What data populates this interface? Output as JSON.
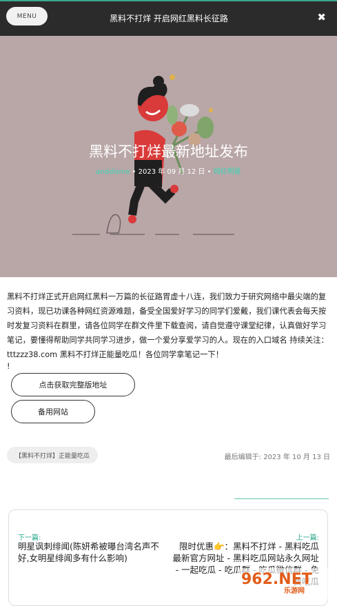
{
  "header": {
    "menu_label": "MENU",
    "title": "黑料不打烊 开启网红黑料长征路",
    "close_symbol": "✖"
  },
  "hero": {
    "title": "黑料不打烊最新地址发布",
    "author": "anddisme",
    "sep": "•",
    "date": "2023 年 09 月 12 日",
    "category": "网红明星",
    "bg_color": "#b9a6a7"
  },
  "article": {
    "body": "黑料不打烊正式开启网红黑料一万篇的长征路胃虚十八连，我们致力于研究网络中最尖端的复习资料，现已功课各种网红资源难题，备受全国爱好学习的同学们爱戴，我们课代表会每天按时发复习资料在群里，请各位同学在群文件里下载查阅，请自觉遵守课堂纪律，认真做好学习笔记，要懂得帮助同学共同学习进步，做一个爱分享爱学习的人。现在的入口域名 持续关注：tttzzz38.com 黑料不打烊正能量吃瓜！各位同学拿笔记一下！",
    "exclaim": "!"
  },
  "buttons": {
    "full_label": "点击获取完整版地址",
    "backup_label": "备用网站"
  },
  "tag": "【黑料不打烊】正能量吃瓜",
  "last_edited": "最后编辑于: 2023 年 10 月 13 日",
  "post_nav": {
    "prev_label": "下一篇:",
    "prev_title": "明星讽刺绯闻(陈妍希被曝台湾名声不好,女明星绯闻多有什么影响)",
    "next_label": "上一篇:",
    "next_title": "限时优惠👉：黑料不打烊 - 黑料吃瓜最新官方网址 - 黑料吃瓜网站永久网址 - 一起吃瓜 - 吃瓜群 - 吃瓜微信群 - 免费吃瓜"
  },
  "watermark": {
    "logo_text": "962.NET",
    "sub_text": "乐游网"
  },
  "colors": {
    "accent": "#3aa890",
    "topbar": "#2b2b2b"
  }
}
